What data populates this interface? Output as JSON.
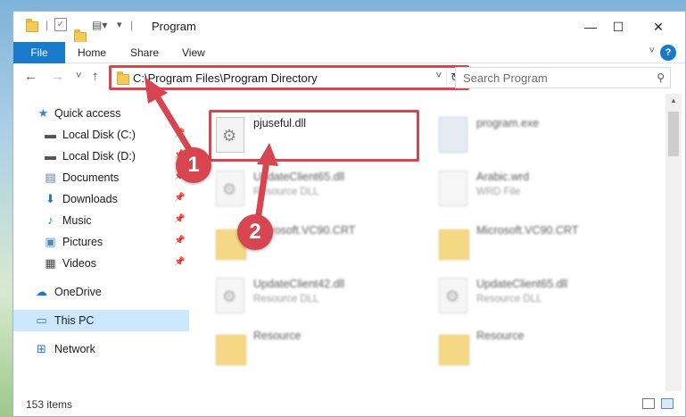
{
  "window": {
    "title": "Program",
    "controls": {
      "minimize": "—",
      "maximize": "☐",
      "close": "✕"
    }
  },
  "ribbon": {
    "file": "File",
    "tabs": [
      "Home",
      "Share",
      "View"
    ],
    "help": "?"
  },
  "nav": {
    "back": "←",
    "forward": "→",
    "recent": "˅",
    "up": "↑",
    "address": "C:\\Program Files\\Program Directory",
    "search_placeholder": "Search Program"
  },
  "sidebar": {
    "items": [
      {
        "label": "Quick access",
        "icon": "star-icon",
        "pinned": false
      },
      {
        "label": "Local Disk (C:)",
        "icon": "drive-icon",
        "pinned": true
      },
      {
        "label": "Local Disk (D:)",
        "icon": "drive-icon",
        "pinned": true
      },
      {
        "label": "Documents",
        "icon": "documents-icon",
        "pinned": true
      },
      {
        "label": "Downloads",
        "icon": "downloads-icon",
        "pinned": true
      },
      {
        "label": "Music",
        "icon": "music-icon",
        "pinned": true
      },
      {
        "label": "Pictures",
        "icon": "pictures-icon",
        "pinned": true
      },
      {
        "label": "Videos",
        "icon": "videos-icon",
        "pinned": true
      },
      {
        "label": "OneDrive",
        "icon": "cloud-icon",
        "pinned": false
      },
      {
        "label": "This PC",
        "icon": "computer-icon",
        "pinned": false,
        "selected": true
      },
      {
        "label": "Network",
        "icon": "network-icon",
        "pinned": false
      }
    ]
  },
  "files": [
    {
      "name": "pjuseful.dll",
      "type": "",
      "kind": "dll",
      "highlighted": true
    },
    {
      "name": "program.exe",
      "type": "",
      "kind": "exe"
    },
    {
      "name": "UpdateClient65.dll",
      "type": "Resource DLL",
      "kind": "dll"
    },
    {
      "name": "Arabic.wrd",
      "type": "WRD File",
      "kind": "file"
    },
    {
      "name": "Microsoft.VC90.CRT",
      "type": "",
      "kind": "folder"
    },
    {
      "name": "Microsoft.VC90.CRT",
      "type": "",
      "kind": "folder"
    },
    {
      "name": "UpdateClient42.dll",
      "type": "Resource DLL",
      "kind": "dll"
    },
    {
      "name": "UpdateClient65.dll",
      "type": "Resource DLL",
      "kind": "dll"
    },
    {
      "name": "Resource",
      "type": "",
      "kind": "folder"
    },
    {
      "name": "Resource",
      "type": "",
      "kind": "folder"
    }
  ],
  "status": {
    "count": "153 items"
  },
  "callouts": {
    "one": "1",
    "two": "2"
  },
  "colors": {
    "accent": "#1979ca",
    "callout": "#d64550",
    "selected": "#cce8ff"
  }
}
